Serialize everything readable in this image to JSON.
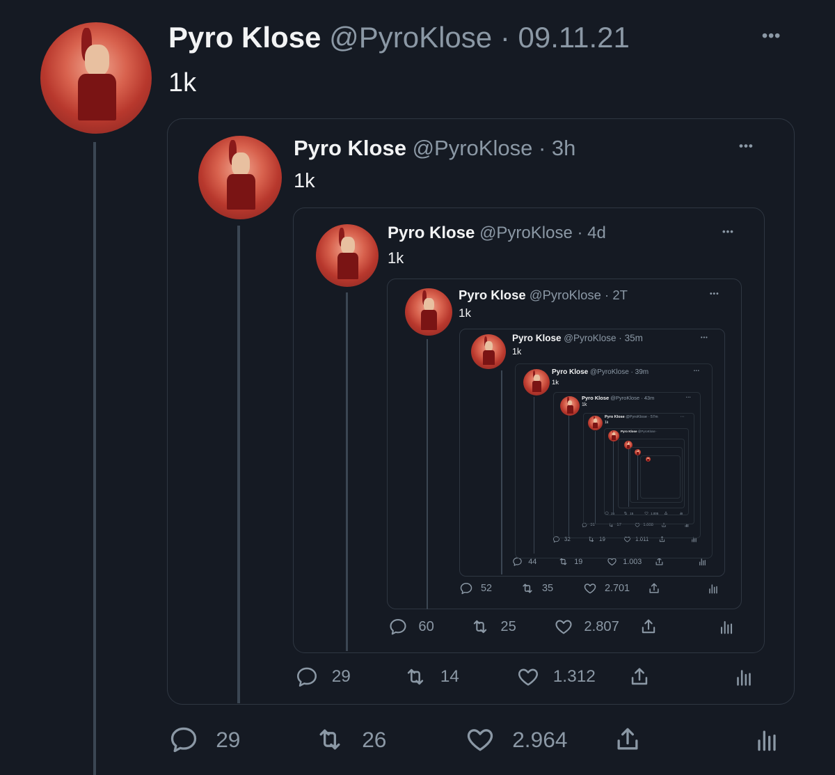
{
  "levels": [
    {
      "name": "Pyro Klose",
      "handle": "@PyroKlose",
      "sep": "·",
      "time": "09.11.21",
      "text": "1k",
      "more": "•••",
      "replies": "29",
      "retweets": "26",
      "likes": "2.964"
    },
    {
      "name": "Pyro Klose",
      "handle": "@PyroKlose",
      "sep": "·",
      "time": "3h",
      "text": "1k",
      "more": "•••",
      "replies": "29",
      "retweets": "14",
      "likes": "1.312"
    },
    {
      "name": "Pyro Klose",
      "handle": "@PyroKlose",
      "sep": "·",
      "time": "4d",
      "text": "1k",
      "more": "•••",
      "replies": "60",
      "retweets": "25",
      "likes": "2.807"
    },
    {
      "name": "Pyro Klose",
      "handle": "@PyroKlose",
      "sep": "·",
      "time": "2T",
      "text": "1k",
      "more": "•••",
      "replies": "52",
      "retweets": "35",
      "likes": "2.701"
    },
    {
      "name": "Pyro Klose",
      "handle": "@PyroKlose",
      "sep": "·",
      "time": "35m",
      "text": "1k",
      "more": "•••",
      "replies": "44",
      "retweets": "19",
      "likes": "1.003"
    },
    {
      "name": "Pyro Klose",
      "handle": "@PyroKlose",
      "sep": "·",
      "time": "39m",
      "text": "1k",
      "more": "•••",
      "replies": "32",
      "retweets": "19",
      "likes": "1.011"
    },
    {
      "name": "Pyro Klose",
      "handle": "@PyroKlose",
      "sep": "·",
      "time": "43m",
      "text": "1k",
      "more": "•••",
      "replies": "31",
      "retweets": "17",
      "likes": "1.008"
    },
    {
      "name": "Pyro Klose",
      "handle": "@PyroKlose",
      "sep": "·",
      "time": "57m",
      "text": "1k",
      "more": "•••",
      "replies": "26",
      "retweets": "15",
      "likes": "1.005"
    },
    {
      "name": "Pyro Klose",
      "handle": "@PyroKlose",
      "sep": "·",
      "time": "",
      "text": "",
      "more": "",
      "replies": "",
      "retweets": "",
      "likes": ""
    },
    {
      "name": "",
      "handle": "",
      "sep": "",
      "time": "",
      "text": "",
      "more": "",
      "replies": "",
      "retweets": "",
      "likes": ""
    },
    {
      "name": "",
      "handle": "",
      "sep": "",
      "time": "",
      "text": "",
      "more": "",
      "replies": "",
      "retweets": "",
      "likes": ""
    },
    {
      "name": "",
      "handle": "",
      "sep": "",
      "time": "",
      "text": "",
      "more": "",
      "replies": "",
      "retweets": "",
      "likes": ""
    }
  ],
  "colors": {
    "background": "#151a23",
    "text": "#e7e9ea",
    "muted": "#8b98a5",
    "border": "#2f3742",
    "avatar_red": "#c23a2d"
  },
  "icons": {
    "reply": "comment-icon",
    "retweet": "retweet-icon",
    "like": "heart-icon",
    "share": "share-icon",
    "stats": "analytics-icon",
    "more": "more-icon"
  }
}
